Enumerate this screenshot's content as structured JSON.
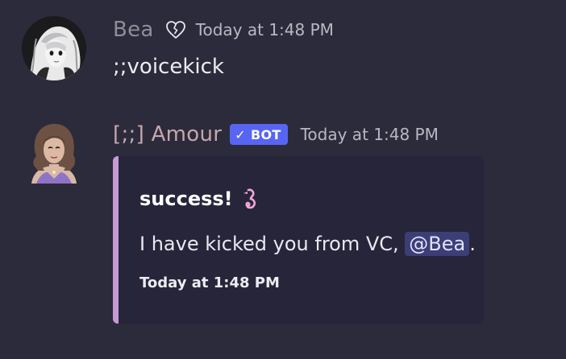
{
  "messages": [
    {
      "author": "Bea",
      "status_icon": "broken-heart-icon",
      "timestamp": "Today at 1:48 PM",
      "content": ";;voicekick"
    },
    {
      "author": "[;;] Amour",
      "badge": "BOT",
      "timestamp": "Today at 1:48 PM",
      "embed": {
        "accent_color": "#c79ad6",
        "title": "success!",
        "title_emoji": "pink-seahorse-emoji",
        "description_prefix": "I have kicked you from VC, ",
        "mention": "@Bea",
        "description_suffix": ".",
        "footer_timestamp": "Today at 1:48 PM"
      }
    }
  ],
  "colors": {
    "background": "#2c2b3b",
    "bot_badge": "#5865f2",
    "mention_bg": "#3c3e75",
    "bea_name": "#8f8d98",
    "amour_name": "#c6a7ab"
  }
}
